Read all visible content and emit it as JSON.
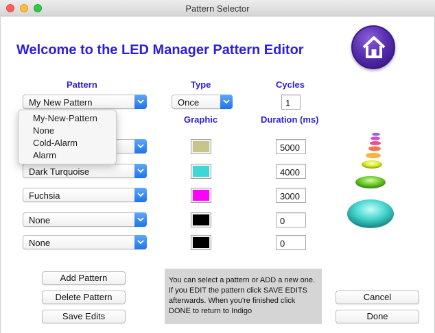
{
  "window": {
    "title": "Pattern Selector"
  },
  "heading": "Welcome to the LED Manager Pattern Editor",
  "columns": {
    "pattern": "Pattern",
    "type": "Type",
    "cycles": "Cycles",
    "graphic": "Graphic",
    "duration": "Duration (ms)"
  },
  "pattern_select": {
    "value": "My New Pattern"
  },
  "type_select": {
    "value": "Once"
  },
  "cycles_field": {
    "value": "1"
  },
  "pattern_menu": {
    "items": [
      "My-New-Pattern",
      "None",
      "Cold-Alarm",
      "Alarm"
    ]
  },
  "rows": [
    {
      "color_name": "",
      "swatch": "#c8c48a",
      "duration": "5000"
    },
    {
      "color_name": "Dark Turquoise",
      "swatch": "#3dd7d6",
      "duration": "4000"
    },
    {
      "color_name": "Fuchsia",
      "swatch": "#ff00ff",
      "duration": "3000"
    },
    {
      "color_name": "None",
      "swatch": "#000000",
      "duration": "0"
    },
    {
      "color_name": "None",
      "swatch": "#000000",
      "duration": "0"
    }
  ],
  "buttons": {
    "add": "Add Pattern",
    "delete": "Delete Pattern",
    "save": "Save Edits",
    "cancel": "Cancel",
    "done": "Done"
  },
  "info_text": "You can select a pattern or ADD a new one. If you EDIT the pattern click SAVE EDITS afterwards.  When you're finished click DONE to return to Indigo",
  "icons": {
    "home": "home-icon",
    "led_stack": "led-stack-graphic",
    "popup_arrow": "chevron-down-icon"
  },
  "colors": {
    "accent": "#2a1ee0",
    "popup_arrow": "#1f73e8"
  }
}
